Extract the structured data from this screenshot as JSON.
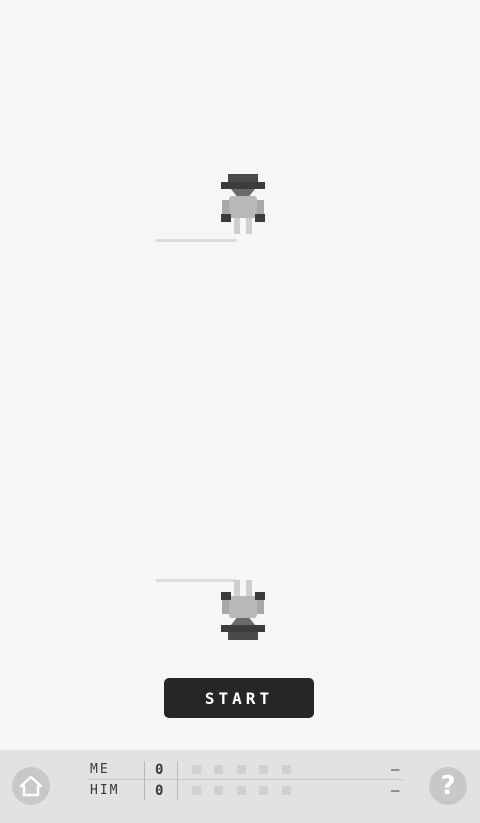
{
  "actions": {
    "start_label": "START"
  },
  "scoreboard": {
    "me": {
      "label": "ME",
      "score": "0",
      "result": "–"
    },
    "him": {
      "label": "HIM",
      "score": "0",
      "result": "–"
    }
  },
  "help": {
    "label": "?"
  },
  "icons": {
    "home": "home-icon",
    "help": "question-mark-icon",
    "opponent": "cowboy-icon",
    "player": "cowboy-icon"
  },
  "colors": {
    "background": "#f6f6f6",
    "button": "#262626",
    "bar": "#e2e2e2",
    "figure_dark": "#3c3c3c",
    "figure_mid": "#9a9a9a"
  }
}
